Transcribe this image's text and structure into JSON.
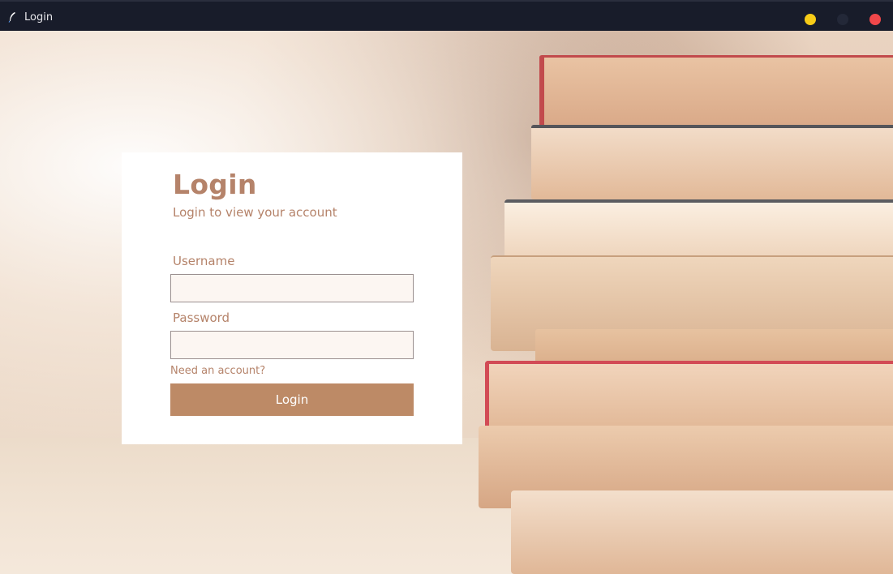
{
  "window": {
    "title": "Login",
    "icons": {
      "app": "feather-icon",
      "minimize": "yellow-circle",
      "maximize": "dark-circle",
      "close": "red-circle"
    },
    "colors": {
      "titlebar": "#181c2a",
      "minimize": "#f7cc17",
      "maximize": "#1b1f2d",
      "close": "#f0474a"
    }
  },
  "login": {
    "heading": "Login",
    "subheading": "Login to view your account",
    "username_label": "Username",
    "username_value": "",
    "password_label": "Password",
    "password_value": "",
    "need_account_link": "Need an account?",
    "submit_label": "Login"
  },
  "colors": {
    "accent": "#b5836a",
    "button": "#bd8a66",
    "field_bg": "#fcf6f2"
  }
}
